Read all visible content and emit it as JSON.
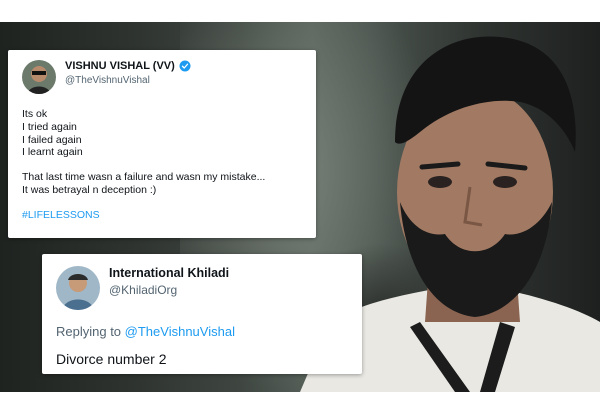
{
  "tweet1": {
    "display_name": "VISHNU VISHAL (VV)",
    "handle": "@TheVishnuVishal",
    "lines": [
      "Its ok",
      "I tried again",
      "I failed again",
      "I learnt again"
    ],
    "lines2": [
      "That last time wasn a failure and  wasn my mistake...",
      "It was betrayal n deception :)"
    ],
    "hashtag": "#LIFELESSONS",
    "verified_icon": "verified-badge-icon",
    "accent_color": "#1d9bf0"
  },
  "tweet2": {
    "display_name": "International Khiladi",
    "handle": "@KhiladiOrg",
    "replying_label": "Replying to",
    "replying_to": "@TheVishnuVishal",
    "text": "Divorce number 2"
  }
}
